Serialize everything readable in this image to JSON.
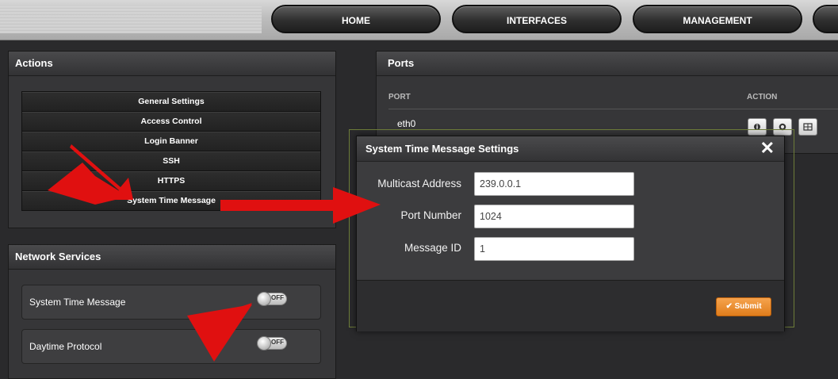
{
  "nav": {
    "items": [
      {
        "label": "HOME"
      },
      {
        "label": "INTERFACES"
      },
      {
        "label": "MANAGEMENT"
      }
    ]
  },
  "actions_panel": {
    "title": "Actions",
    "items": [
      {
        "label": "General Settings"
      },
      {
        "label": "Access Control"
      },
      {
        "label": "Login Banner"
      },
      {
        "label": "SSH"
      },
      {
        "label": "HTTPS"
      },
      {
        "label": "System Time Message"
      }
    ]
  },
  "network_services": {
    "title": "Network Services",
    "rows": [
      {
        "label": "System Time Message",
        "toggle": "OFF"
      },
      {
        "label": "Daytime Protocol",
        "toggle": "OFF"
      }
    ]
  },
  "ports_panel": {
    "title": "Ports",
    "columns": {
      "port": "PORT",
      "action": "ACTION"
    },
    "rows": [
      {
        "port": "eth0"
      }
    ]
  },
  "modal": {
    "title": "System Time Message Settings",
    "close_glyph": "✕",
    "fields": {
      "multicast": {
        "label": "Multicast Address",
        "value": "239.0.0.1"
      },
      "port": {
        "label": "Port Number",
        "value": "1024"
      },
      "message_id": {
        "label": "Message ID",
        "value": "1"
      }
    },
    "submit_label": "Submit",
    "submit_icon": "✔"
  },
  "colors": {
    "accent_orange": "#e8891f",
    "annotation_arrow": "#e01010"
  }
}
